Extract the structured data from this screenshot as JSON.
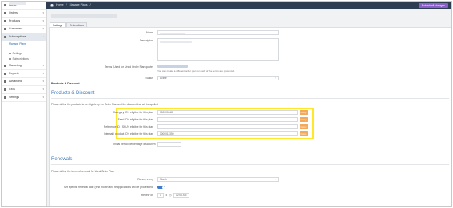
{
  "sidebar": {
    "items": [
      {
        "label": "Home"
      },
      {
        "label": "Orders"
      },
      {
        "label": "Products"
      },
      {
        "label": "Customers"
      },
      {
        "label": "Subscriptions"
      }
    ],
    "sub_items": [
      {
        "label": "Manage Plans"
      }
    ],
    "subsection": {
      "label": ""
    },
    "sub_items2": [
      {
        "label": "Settings"
      },
      {
        "label": "Subscriptions"
      }
    ],
    "items2": [
      {
        "label": "Marketing"
      },
      {
        "label": "Reports"
      },
      {
        "label": "Advanced"
      },
      {
        "label": "CMS"
      },
      {
        "label": "Settings"
      }
    ]
  },
  "topbar": {
    "breadcrumb": [
      "Home",
      "/",
      "Manage Plans",
      "/"
    ],
    "publish_label": "Publish all changes"
  },
  "tabs": [
    {
      "label": "Settings"
    },
    {
      "label": "Subscribers"
    }
  ],
  "form": {
    "name_label": "Name",
    "description_label": "Description",
    "terms_label": "Terms (Used for Unrol Order Plan quote)",
    "terms_note": "You can create a different order plan for each of the terms are presented.",
    "status_label": "Status",
    "status_value": "Active",
    "products_label": "Products & Discount"
  },
  "products": {
    "heading": "Products & Discount",
    "intro": "Please define the products to be eligible by the Order Plan and the discount that will be applied",
    "fields": [
      {
        "label": "Category ID's eligible for this plan",
        "value": "000000048",
        "button": "Copy"
      },
      {
        "label": "Feed ID's eligible for this plan",
        "value": "",
        "button": "Copy"
      },
      {
        "label": "Reference ID / SKU's eligible for this plan",
        "value": "",
        "button": "Copy"
      },
      {
        "label": "Internal / product ID's eligible for this plan",
        "value": "1000011350",
        "button": "Copy"
      }
    ],
    "discount_label": "Initial period percentage discount",
    "discount_unit": "%"
  },
  "renewals": {
    "heading": "Renewals",
    "intro": "Please define the terms of renewal for Unrol Order Plan",
    "renew_every_label": "Renew every",
    "renew_every_value": "Month",
    "specific_date_label": "Set specific renewal date (first month and reapplications will be processed)",
    "renew_on_label": "Renew on",
    "renew_day": "1",
    "renew_time": "12:00 AM"
  },
  "colors": {
    "highlight": "#ffe82a",
    "accent_button": "#f3a95b",
    "publish_button": "#8a5fc7",
    "topbar": "#2e3e52",
    "section_heading": "#3d79b9"
  }
}
